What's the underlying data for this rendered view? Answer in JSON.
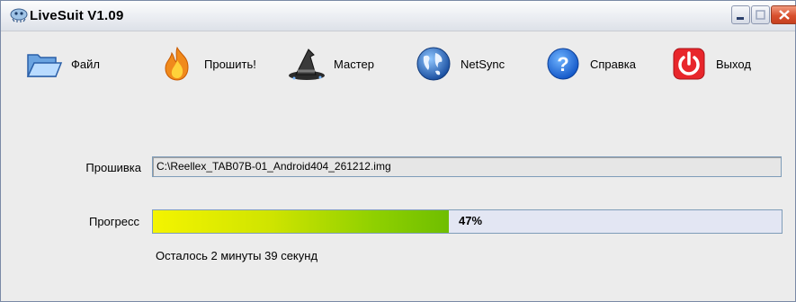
{
  "window": {
    "title": "LiveSuit V1.09"
  },
  "toolbar": [
    {
      "label": "Файл",
      "icon": "open-folder-icon"
    },
    {
      "label": "Прошить!",
      "icon": "flame-icon"
    },
    {
      "label": "Мастер",
      "icon": "wizard-hat-icon"
    },
    {
      "label": "NetSync",
      "icon": "globe-icon"
    },
    {
      "label": "Справка",
      "icon": "help-icon"
    },
    {
      "label": "Выход",
      "icon": "power-icon"
    }
  ],
  "firmware": {
    "label": "Прошивка",
    "path": "C:\\Reellex_TAB07B-01_Android404_261212.img"
  },
  "progress": {
    "label": "Прогресс",
    "value": 0.47,
    "text": "47%",
    "remaining": "Осталось 2 минуты 39 секунд"
  },
  "colors": {
    "progress_start": "#f4f400",
    "progress_end": "#6fbe00",
    "track": "#e3e6f3"
  }
}
